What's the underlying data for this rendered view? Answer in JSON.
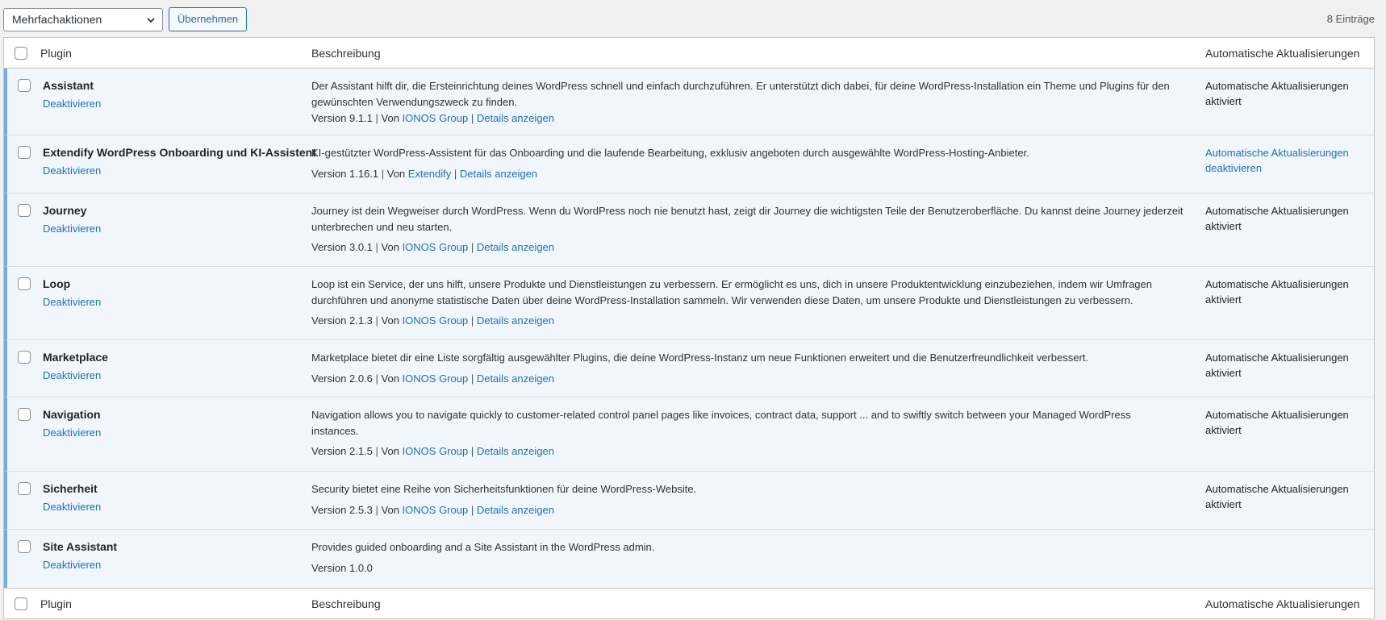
{
  "toolbar": {
    "bulk_action": "Mehrfachaktionen",
    "apply_label": "Übernehmen",
    "count": "8 Einträge"
  },
  "table": {
    "col_plugin": "Plugin",
    "col_description": "Beschreibung",
    "col_auto_updates": "Automatische Aktualisierungen"
  },
  "plugins": [
    {
      "name": "Assistant",
      "deactivate": "Deaktivieren",
      "description": "Der Assistant hilft dir, die Ersteinrichtung deines WordPress schnell und einfach durchzuführen. Er unterstützt dich dabei, für deine WordPress-Installation ein Theme und Plugins für den gewünschten Verwendungszweck zu finden.",
      "version": "Version 9.1.1",
      "by": "Von",
      "author": "IONOS Group",
      "details": "Details anzeigen",
      "auto_line1": "Automatische Aktualisierungen",
      "auto_line2": "aktiviert"
    },
    {
      "name": "Extendify WordPress Onboarding und KI-Assistent",
      "deactivate": "Deaktivieren",
      "description": "KI-gestützter WordPress-Assistent für das Onboarding und die laufende Bearbeitung, exklusiv angeboten durch ausgewählte WordPress-Hosting-Anbieter.",
      "version": "Version 1.16.1",
      "by": "Von",
      "author": "Extendify",
      "details": "Details anzeigen",
      "auto_line1": "Automatische Aktualisierungen",
      "auto_line2": "deaktivieren"
    },
    {
      "name": "Journey",
      "deactivate": "Deaktivieren",
      "description": "Journey ist dein Wegweiser durch WordPress. Wenn du WordPress noch nie benutzt hast, zeigt dir Journey die wichtigsten Teile der Benutzeroberfläche. Du kannst deine Journey jederzeit unterbrechen und neu starten.",
      "version": "Version 3.0.1",
      "by": "Von",
      "author": "IONOS Group",
      "details": "Details anzeigen",
      "auto_line1": "Automatische Aktualisierungen",
      "auto_line2": "aktiviert"
    },
    {
      "name": "Loop",
      "deactivate": "Deaktivieren",
      "description": "Loop ist ein Service, der uns hilft, unsere Produkte und Dienstleistungen zu verbessern. Er ermöglicht es uns, dich in unsere Produktentwicklung einzubeziehen, indem wir Umfragen durchführen und anonyme statistische Daten über deine WordPress-Installation sammeln. Wir verwenden diese Daten, um unsere Produkte und Dienstleistungen zu verbessern.",
      "version": "Version 2.1.3",
      "by": "Von",
      "author": "IONOS Group",
      "details": "Details anzeigen",
      "auto_line1": "Automatische Aktualisierungen",
      "auto_line2": "aktiviert"
    },
    {
      "name": "Marketplace",
      "deactivate": "Deaktivieren",
      "description": "Marketplace bietet dir eine Liste sorgfältig ausgewählter Plugins, die deine WordPress-Instanz um neue Funktionen erweitert und die Benutzerfreundlichkeit verbessert.",
      "version": "Version 2.0.6",
      "by": "Von",
      "author": "IONOS Group",
      "details": "Details anzeigen",
      "auto_line1": "Automatische Aktualisierungen",
      "auto_line2": "aktiviert"
    },
    {
      "name": "Navigation",
      "deactivate": "Deaktivieren",
      "description": "Navigation allows you to navigate quickly to customer-related control panel pages like invoices, contract data, support ... and to swiftly switch between your Managed WordPress instances.",
      "version": "Version 2.1.5",
      "by": "Von",
      "author": "IONOS Group",
      "details": "Details anzeigen",
      "auto_line1": "Automatische Aktualisierungen",
      "auto_line2": "aktiviert"
    },
    {
      "name": "Sicherheit",
      "deactivate": "Deaktivieren",
      "description": "Security bietet eine Reihe von Sicherheitsfunktionen für deine WordPress-Website.",
      "version": "Version 2.5.3",
      "by": "Von",
      "author": "IONOS Group",
      "details": "Details anzeigen",
      "auto_line1": "Automatische Aktualisierungen",
      "auto_line2": "aktiviert"
    },
    {
      "name": "Site Assistant",
      "deactivate": "Deaktivieren",
      "description": "Provides guided onboarding and a Site Assistant in the WordPress admin.",
      "version": "Version 1.0.0"
    }
  ]
}
